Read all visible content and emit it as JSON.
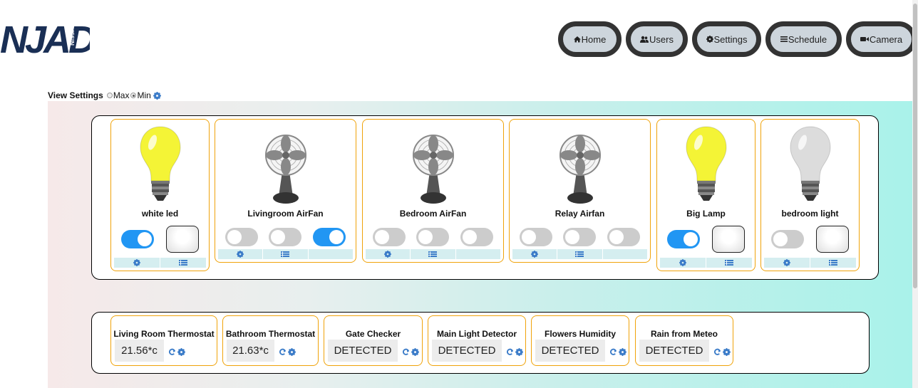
{
  "logo": {
    "main": "NJAD",
    "sub": "Nissi"
  },
  "nav": [
    {
      "label": "Home",
      "icon": "home-icon"
    },
    {
      "label": "Users",
      "icon": "users-icon"
    },
    {
      "label": "Settings",
      "icon": "gear-icon"
    },
    {
      "label": "Schedule",
      "icon": "list-icon"
    },
    {
      "label": "Camera",
      "icon": "video-camera-icon"
    }
  ],
  "view_settings": {
    "label": "View Settings",
    "options": [
      {
        "label": "Max",
        "selected": false
      },
      {
        "label": "Min",
        "selected": true
      }
    ]
  },
  "devices": [
    {
      "name": "white led",
      "type": "bulb",
      "bulb_color": "#f4f436",
      "controls": [
        "toggle-on",
        "button"
      ]
    },
    {
      "name": "Livingroom AirFan",
      "type": "fan",
      "controls": [
        "toggle-off",
        "toggle-off",
        "toggle-on"
      ]
    },
    {
      "name": "Bedroom AirFan",
      "type": "fan",
      "controls": [
        "toggle-off",
        "toggle-off",
        "toggle-off"
      ]
    },
    {
      "name": "Relay Airfan",
      "type": "fan",
      "controls": [
        "toggle-off",
        "toggle-off",
        "toggle-off"
      ]
    },
    {
      "name": "Big Lamp",
      "type": "bulb",
      "bulb_color": "#f4f436",
      "controls": [
        "toggle-on",
        "button"
      ]
    },
    {
      "name": "bedroom light",
      "type": "bulb",
      "bulb_color": "#dcdcdc",
      "controls": [
        "toggle-off",
        "button"
      ]
    }
  ],
  "sensors": [
    {
      "title": "Living Room Thermostat",
      "value": "21.56*c"
    },
    {
      "title": "Bathroom Thermostat",
      "value": "21.63*c"
    },
    {
      "title": "Gate Checker",
      "value": "DETECTED"
    },
    {
      "title": "Main Light Detector",
      "value": "DETECTED"
    },
    {
      "title": "Flowers Humidity",
      "value": "DETECTED"
    },
    {
      "title": "Rain from Meteo",
      "value": "DETECTED"
    }
  ],
  "colors": {
    "accent": "#2196f3",
    "card_border": "#f0a30a",
    "icon_blue": "#3a7bc8",
    "nav_bg": "#cdd5dc"
  }
}
